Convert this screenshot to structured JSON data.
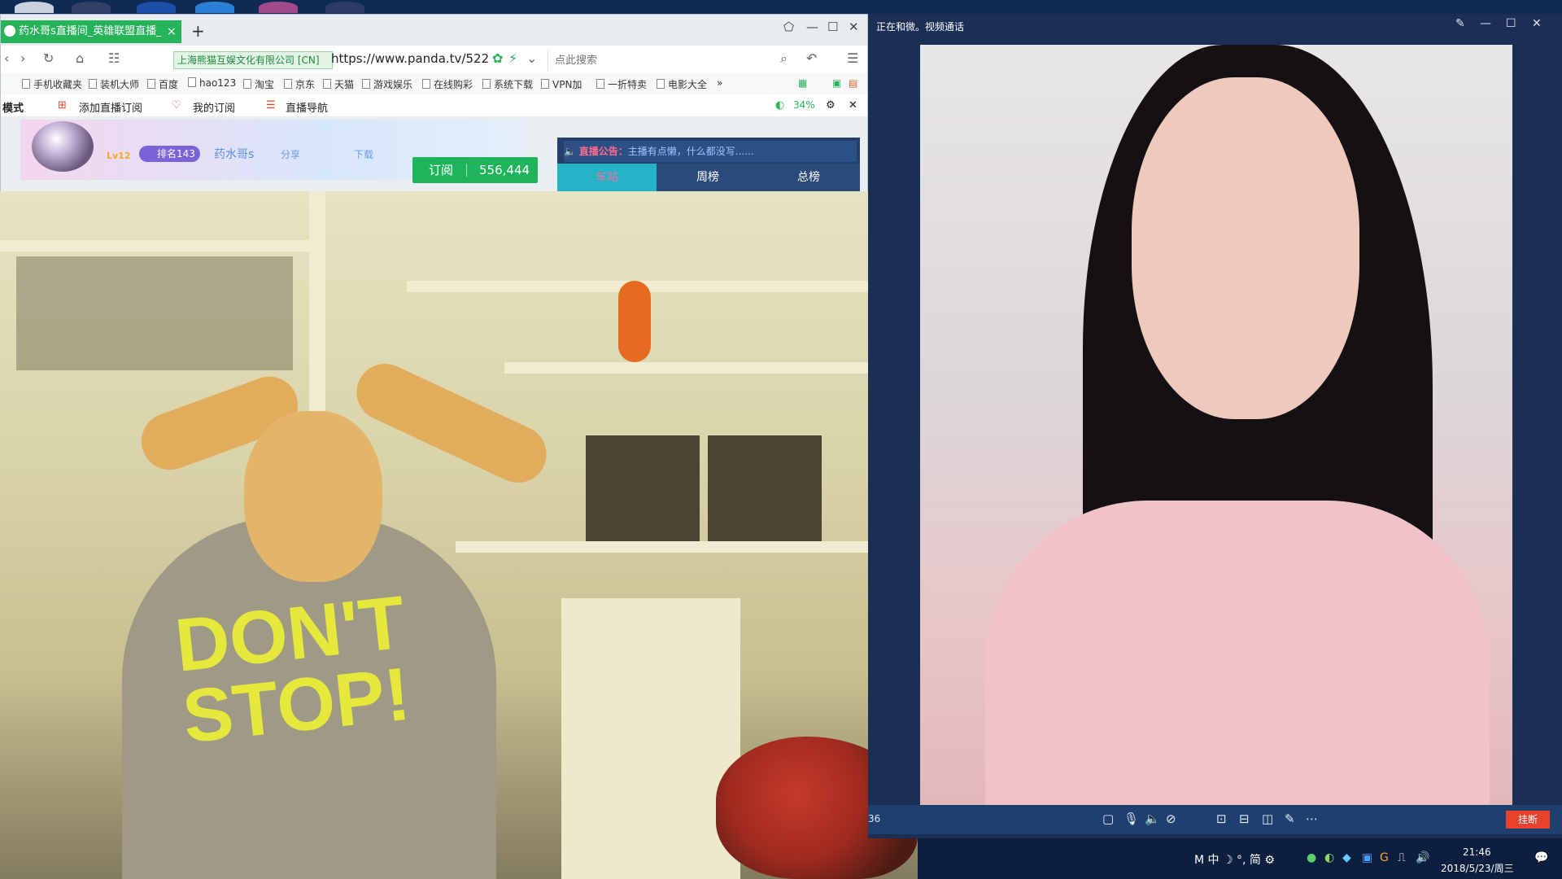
{
  "browser": {
    "tab_title": "药水哥s直播间_英雄联盟直播_lo",
    "tab_close": "×",
    "new_tab": "+",
    "cert_text": "上海熊猫互娱文化有限公司 [CN]",
    "url": "https://www.panda.tv/522",
    "search_placeholder": "点此搜索",
    "bookmarks": [
      "手机收藏夹",
      "装机大师",
      "百度",
      "hao123",
      "淘宝",
      "京东",
      "天猫",
      "游戏娱乐",
      "在线购彩",
      "系统下载",
      "VPN加",
      "一折特卖",
      "电影大全"
    ],
    "bookmarks_more": "»",
    "toolbar_items": [
      "模式",
      "添加直播订阅",
      "我的订阅",
      "直播导航"
    ],
    "battery": "34%",
    "colors": {
      "accent": "#26b35a"
    }
  },
  "stream": {
    "level": "Lv12",
    "rank": "排名143",
    "anchor_name": "药水哥s",
    "share": "分享",
    "download": "下载",
    "subscribe_label": "订阅",
    "subscribe_count": "556,444",
    "notice_label": "直播公告：",
    "notice_text": "主播有点懒，什么都没写......",
    "right_tabs": [
      "车站",
      "周榜",
      "总榜"
    ]
  },
  "video": {
    "shirt_line1": "DON'T",
    "shirt_line2": "STOP!"
  },
  "call": {
    "title": "正在和微。视频通话",
    "timer": "36",
    "hangup": "挂断"
  },
  "taskbar": {
    "ime_text": "M 中 ☽ °, 简 ⚙",
    "time": "21:46",
    "date": "2018/5/23/周三"
  }
}
